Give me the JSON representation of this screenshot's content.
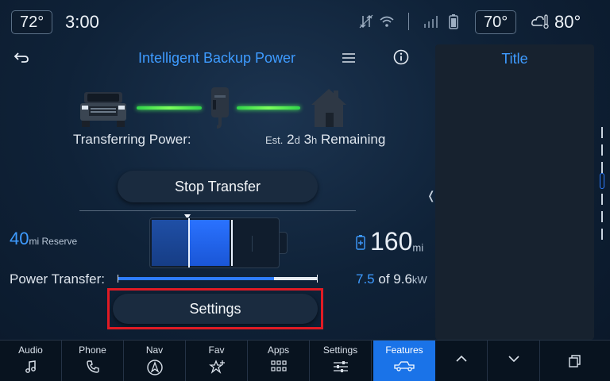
{
  "status": {
    "left_temp": "72°",
    "time": "3:00",
    "right_temp": "70°",
    "outside_temp": "80°",
    "icons": [
      "no-signal-arrows-icon",
      "wifi-icon",
      "cellular-signal-icon",
      "phone-battery-icon",
      "weather-cloud-icon"
    ]
  },
  "main": {
    "title": "Intelligent Backup Power",
    "transferring_label": "Transferring Power:",
    "remaining": {
      "prefix": "Est.",
      "days": "2",
      "days_unit": "d",
      "hours": "3",
      "hours_unit": "h",
      "suffix": "Remaining"
    },
    "stop_button": "Stop Transfer",
    "reserve": {
      "value": "40",
      "unit": "mi Reserve"
    },
    "range": {
      "value": "160",
      "unit": "mi"
    },
    "power_transfer": {
      "label": "Power Transfer:",
      "current": "7.5",
      "of_text": "of 9.6",
      "unit": "kW",
      "fraction": 0.78
    },
    "settings_button": "Settings"
  },
  "side_panel": {
    "title": "Title"
  },
  "nav": {
    "items": [
      {
        "label": "Audio",
        "icon": "music-note-icon"
      },
      {
        "label": "Phone",
        "icon": "phone-icon"
      },
      {
        "label": "Nav",
        "icon": "navigation-arrow-icon"
      },
      {
        "label": "Fav",
        "icon": "star-plus-icon"
      },
      {
        "label": "Apps",
        "icon": "apps-grid-icon"
      },
      {
        "label": "Settings",
        "icon": "sliders-icon"
      },
      {
        "label": "Features",
        "icon": "truck-icon"
      }
    ],
    "active": "Features"
  },
  "colors": {
    "accent": "#3e9bff",
    "active_tab": "#1a73e8",
    "flow_green": "#4eff58",
    "highlight_red": "#e01b24"
  }
}
